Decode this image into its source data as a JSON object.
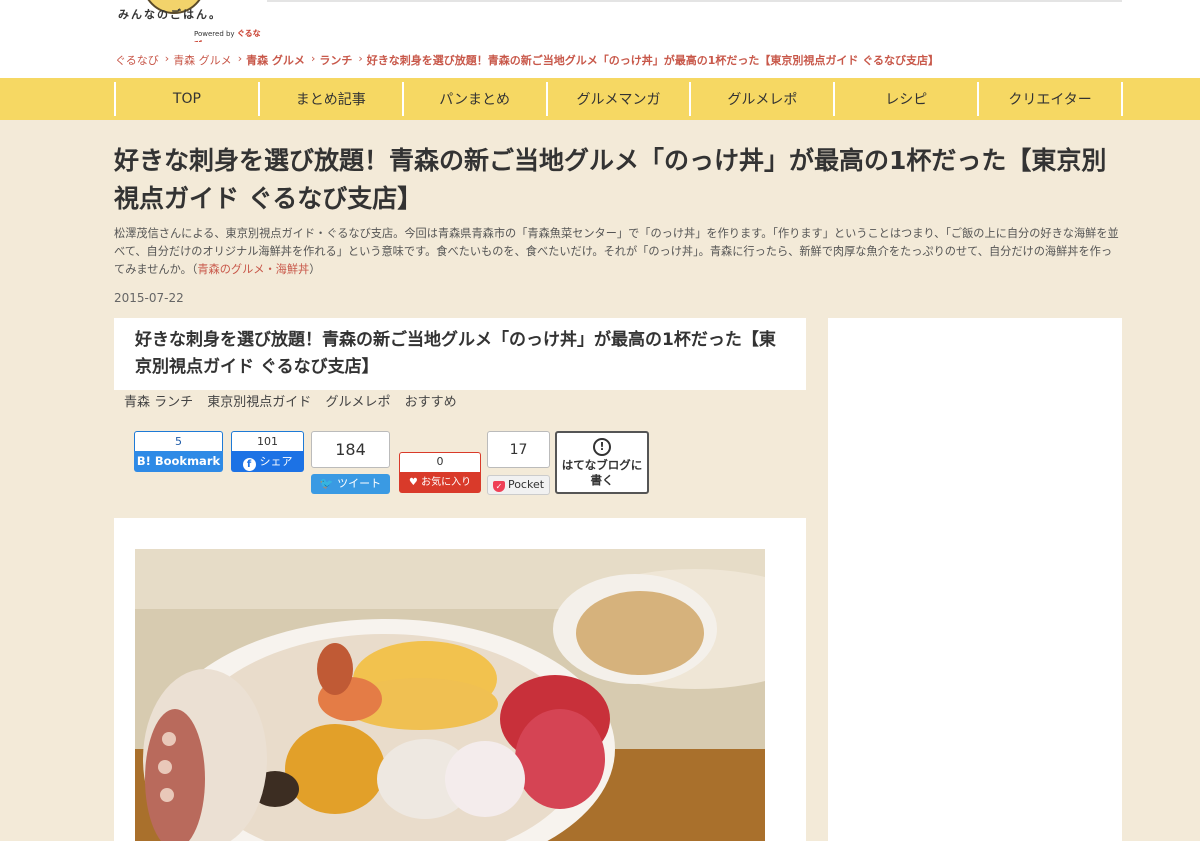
{
  "header": {
    "logo_text": "みんなのごはん。",
    "logo_powered": "Powered by",
    "logo_brand": "ぐるなび"
  },
  "breadcrumb": [
    {
      "label": "ぐるなび"
    },
    {
      "label": "青森 グルメ"
    },
    {
      "label": "青森 グルメ"
    },
    {
      "label": "ランチ"
    },
    {
      "label": "好きな刺身を選び放題！青森の新ご当地グルメ「のっけ丼」が最高の1杯だった【東京別視点ガイド ぐるなび支店】"
    }
  ],
  "nav": [
    {
      "label": "TOP"
    },
    {
      "label": "まとめ記事"
    },
    {
      "label": "パンまとめ"
    },
    {
      "label": "グルメマンガ"
    },
    {
      "label": "グルメレポ"
    },
    {
      "label": "レシピ"
    },
    {
      "label": "クリエイター"
    }
  ],
  "page": {
    "title": "好きな刺身を選び放題！青森の新ご当地グルメ「のっけ丼」が最高の1杯だった【東京別視点ガイド ぐるなび支店】",
    "lead": "松澤茂信さんによる、東京別視点ガイド・ぐるなび支店。今回は青森県青森市の「青森魚菜センター」で「のっけ丼」を作ります。「作ります」ということはつまり、「ご飯の上に自分の好きな海鮮を並べて、自分だけのオリジナル海鮮丼を作れる」という意味です。食べたいものを、食べたいだけ。それが「のっけ丼」。青森に行ったら、新鮮で肉厚な魚介をたっぷりのせて、自分だけの海鮮丼を作ってみませんか。（",
    "lead_link": "青森のグルメ・海鮮丼",
    "lead_close": "）",
    "date": "2015-07-22"
  },
  "article": {
    "title": "好きな刺身を選び放題！青森の新ご当地グルメ「のっけ丼」が最高の1杯だった【東京別視点ガイド ぐるなび支店】",
    "tags": [
      "青森 ランチ",
      "東京別視点ガイド",
      "グルメレポ",
      "おすすめ"
    ]
  },
  "social": {
    "hatena_count": "5",
    "hatena_label": "B! Bookmark",
    "facebook_count": "101",
    "facebook_label": "シェア",
    "twitter_count": "184",
    "twitter_label": "ツイート",
    "favorite_count": "0",
    "favorite_label": "お気に入り",
    "pocket_count": "17",
    "pocket_label": "Pocket",
    "hatena_blog_label": "はてなブログに書く"
  },
  "colors": {
    "nav_bg": "#f6d863",
    "page_bg": "#f3ead8",
    "link": "#c8584a",
    "hatena": "#2e8ae6",
    "facebook": "#1c72e5",
    "twitter": "#3a9ae3",
    "favorite": "#d93a2a"
  }
}
